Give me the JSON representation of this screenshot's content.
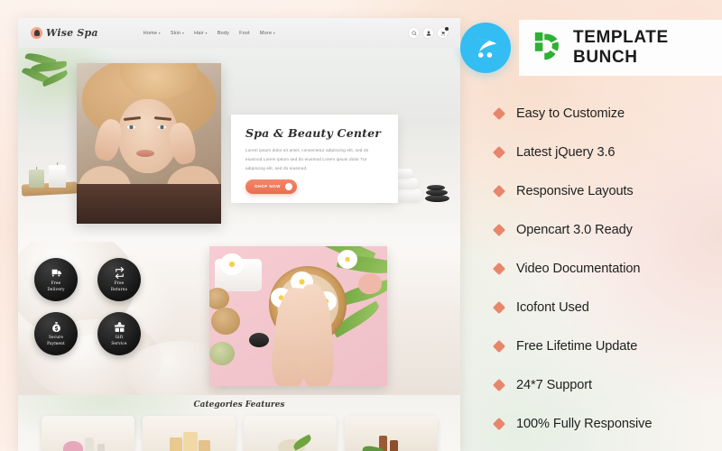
{
  "colors": {
    "accent_salmon": "#e8866c",
    "opencart_blue": "#33bdf2",
    "brand_green": "#2db134",
    "badge_dark": "#141414",
    "shop_button": "#ea6f51"
  },
  "brand": {
    "opencart_icon": "shopping-cart-icon",
    "template_bunch_icon": "template-bunch-logo-icon",
    "template_bunch_text": "TEMPLATE BUNCH"
  },
  "features": [
    {
      "label": "Easy to Customize"
    },
    {
      "label": "Latest jQuery 3.6"
    },
    {
      "label": "Responsive Layouts"
    },
    {
      "label": "Opencart 3.0 Ready"
    },
    {
      "label": "Video Documentation"
    },
    {
      "label": "Icofont Used"
    },
    {
      "label": "Free Lifetime Update"
    },
    {
      "label": "24*7 Support"
    },
    {
      "label": "100% Fully Responsive"
    }
  ],
  "site": {
    "header": {
      "logo_text": "Wise Spa",
      "logo_icon": "spa-bell-icon",
      "nav": [
        {
          "label": "Home",
          "has_dropdown": true
        },
        {
          "label": "Skin",
          "has_dropdown": true
        },
        {
          "label": "Hair",
          "has_dropdown": true
        },
        {
          "label": "Body",
          "has_dropdown": false
        },
        {
          "label": "Foot",
          "has_dropdown": false
        },
        {
          "label": "More",
          "has_dropdown": true
        }
      ],
      "caret": "▾",
      "icons": [
        {
          "name": "search-icon"
        },
        {
          "name": "user-account-icon"
        },
        {
          "name": "shopping-cart-icon"
        }
      ]
    },
    "hero": {
      "title": "Spa & Beauty Center",
      "description": "Lorem ipsum dolor sit amet, consectetur adipiscing elit, sed do eiusmod Lorem ipsum sed do eiusmod Lorem ipsum dolor Tur adipiscing elit, sed do eiusmod.",
      "button_label": "SHOP NOW",
      "button_arrow": "›"
    },
    "badges": [
      {
        "icon": "truck-icon",
        "line1": "Free",
        "line2": "Delivery"
      },
      {
        "icon": "returns-icon",
        "line1": "Free",
        "line2": "Returns"
      },
      {
        "icon": "money-bag-icon",
        "line1": "Secure",
        "line2": "Payment"
      },
      {
        "icon": "gift-icon",
        "line1": "Gift",
        "line2": "Service"
      }
    ],
    "categories": {
      "title": "Categories Features",
      "cards": [
        {
          "name": "category-card-1"
        },
        {
          "name": "category-card-2"
        },
        {
          "name": "category-card-3"
        },
        {
          "name": "category-card-4"
        }
      ]
    }
  }
}
